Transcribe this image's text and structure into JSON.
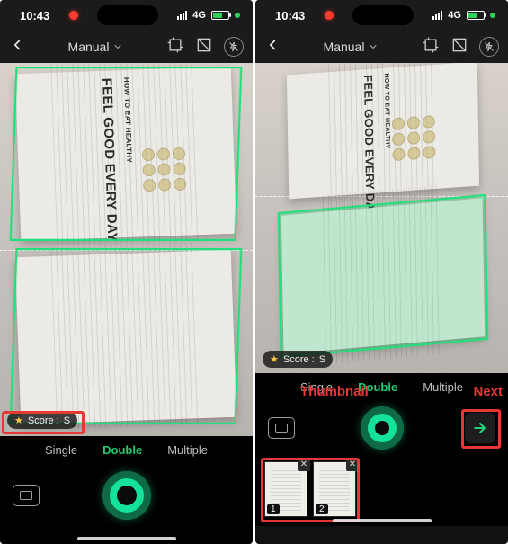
{
  "status": {
    "time": "10:43",
    "network": "4G"
  },
  "topbar": {
    "title": "Manual"
  },
  "document": {
    "headline": "FEEL GOOD EVERY DAY",
    "subhead": "HOW TO EAT HEALTHY"
  },
  "score": {
    "label_prefix": "Score :",
    "value": "S"
  },
  "modes": {
    "single": "Single",
    "double": "Double",
    "multiple": "Multiple",
    "active": "double"
  },
  "thumbnails": [
    {
      "index": "1"
    },
    {
      "index": "2"
    }
  ],
  "annotations": {
    "next": "Next",
    "thumbnail": "Thumbnail"
  }
}
